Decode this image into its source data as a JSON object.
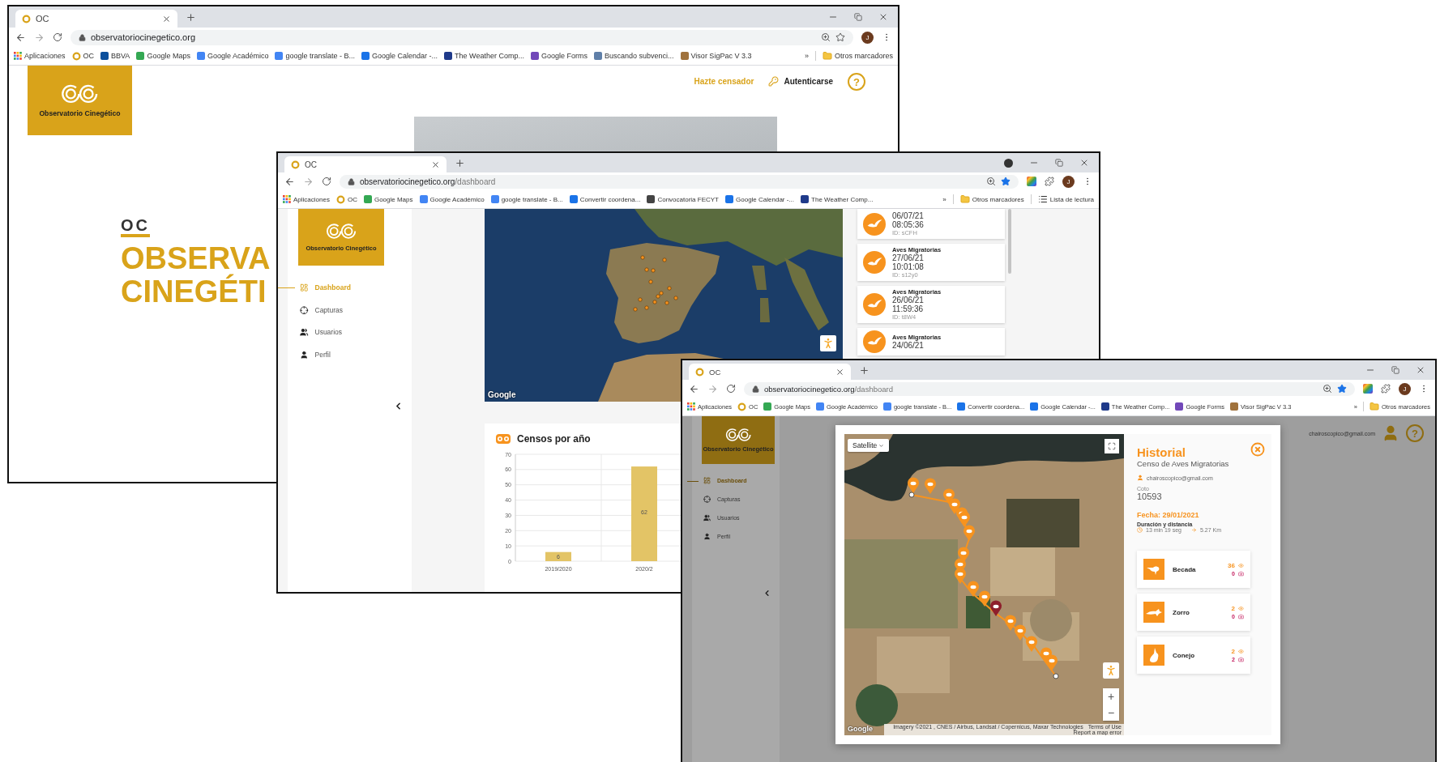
{
  "windows": [
    {
      "kind": "landing",
      "tab": "OC",
      "url": {
        "host": "observatoriocinegetico.org"
      },
      "bookmarked": false,
      "extensions": false,
      "media_indicator": false,
      "profile_initial": "J",
      "bookmarks": [
        {
          "label": "Aplicaciones",
          "kind": "apps"
        },
        {
          "label": "OC",
          "kind": "ring"
        },
        {
          "label": "BBVA",
          "kind": "site",
          "color": "#0b4f9c"
        },
        {
          "label": "Google Maps",
          "kind": "site",
          "color": "#34a853"
        },
        {
          "label": "Google Académico",
          "kind": "site",
          "color": "#4285f4"
        },
        {
          "label": "google translate - B...",
          "kind": "site",
          "color": "#4285f4"
        },
        {
          "label": "Google Calendar -...",
          "kind": "site",
          "color": "#1a73e8"
        },
        {
          "label": "The Weather Comp...",
          "kind": "site",
          "color": "#1f3a8a"
        },
        {
          "label": "Google Forms",
          "kind": "site",
          "color": "#7248b9"
        },
        {
          "label": "Buscando subvenci...",
          "kind": "site",
          "color": "#5f7fa8"
        },
        {
          "label": "Visor SigPac V 3.3",
          "kind": "site",
          "color": "#a0723c"
        },
        {
          "label": "»",
          "kind": "overflow"
        },
        {
          "label": "Otros marcadores",
          "kind": "folder"
        }
      ],
      "page": {
        "logo": "Observatorio Cinegético",
        "links": [
          {
            "label": "Hazte censador",
            "kind": "link"
          },
          {
            "label": "Autenticarse",
            "kind": "login"
          }
        ],
        "help": "?",
        "eyebrow": "OC",
        "headline": [
          "OBSERVA",
          "CINEGÉTI"
        ]
      }
    },
    {
      "kind": "dashboard",
      "tab": "OC",
      "url": {
        "host": "observatoriocinegetico.org",
        "path": "/dashboard"
      },
      "bookmarked": true,
      "extensions": true,
      "media_indicator": true,
      "profile_initial": "J",
      "bookmarks": [
        {
          "label": "Aplicaciones",
          "kind": "apps"
        },
        {
          "label": "OC",
          "kind": "ring"
        },
        {
          "label": "Google Maps",
          "kind": "site",
          "color": "#34a853"
        },
        {
          "label": "Google Académico",
          "kind": "site",
          "color": "#4285f4"
        },
        {
          "label": "google translate - B...",
          "kind": "site",
          "color": "#4285f4"
        },
        {
          "label": "Convertir coordena...",
          "kind": "site",
          "color": "#1a73e8"
        },
        {
          "label": "Convocatoria FECYT",
          "kind": "site",
          "color": "#444444"
        },
        {
          "label": "Google Calendar -...",
          "kind": "site",
          "color": "#1a73e8"
        },
        {
          "label": "The Weather Comp...",
          "kind": "site",
          "color": "#1f3a8a"
        },
        {
          "label": "»",
          "kind": "overflow"
        },
        {
          "label": "Otros marcadores",
          "kind": "folder"
        },
        {
          "label": "Lista de lectura",
          "kind": "reading"
        }
      ],
      "page": {
        "logo": "Observatorio Cinegético",
        "nav": [
          {
            "label": "Dashboard",
            "selected": true
          },
          {
            "label": "Capturas",
            "selected": false
          },
          {
            "label": "Usuarios",
            "selected": false
          },
          {
            "label": "Perfil",
            "selected": false
          }
        ],
        "map_credit": "Google",
        "records": [
          {
            "date": "06/07/21",
            "time": "08:05:36",
            "id": "ID: sCFH"
          },
          {
            "title": "Aves Migratorias",
            "date": "27/06/21",
            "time": "10:01:08",
            "id": "ID: s12y0"
          },
          {
            "title": "Aves Migratorias",
            "date": "26/06/21",
            "time": "11:59:36",
            "id": "ID: t8W4"
          },
          {
            "title": "Aves Migratorias",
            "date": "24/06/21"
          }
        ],
        "chart": {
          "title": "Censos por año",
          "chart_data": {
            "type": "bar",
            "categories": [
              "2019/2020",
              "2020/2"
            ],
            "values": [
              6,
              62
            ],
            "ylim": [
              0,
              70
            ],
            "grid": true,
            "yticks": [
              0,
              10,
              20,
              30,
              40,
              50,
              60,
              70
            ],
            "data_labels": true
          }
        }
      }
    },
    {
      "kind": "history",
      "tab": "OC",
      "url": {
        "host": "observatoriocinegetico.org",
        "path": "/dashboard"
      },
      "bookmarked": true,
      "extensions": true,
      "media_indicator": false,
      "profile_initial": "J",
      "bookmarks": [
        {
          "label": "Aplicaciones",
          "kind": "apps"
        },
        {
          "label": "OC",
          "kind": "ring"
        },
        {
          "label": "Google Maps",
          "kind": "site",
          "color": "#34a853"
        },
        {
          "label": "Google Académico",
          "kind": "site",
          "color": "#4285f4"
        },
        {
          "label": "google translate - B...",
          "kind": "site",
          "color": "#4285f4"
        },
        {
          "label": "Convertir coordena...",
          "kind": "site",
          "color": "#1a73e8"
        },
        {
          "label": "Google Calendar -...",
          "kind": "site",
          "color": "#1a73e8"
        },
        {
          "label": "The Weather Comp...",
          "kind": "site",
          "color": "#1f3a8a"
        },
        {
          "label": "Google Forms",
          "kind": "site",
          "color": "#7248b9"
        },
        {
          "label": "Visor SigPac V 3.3",
          "kind": "site",
          "color": "#a0723c"
        },
        {
          "label": "»",
          "kind": "overflow"
        },
        {
          "label": "Otros marcadores",
          "kind": "folder"
        }
      ],
      "page": {
        "logo": "Observatorio Cinegético",
        "nav": [
          {
            "label": "Dashboard",
            "selected": true
          },
          {
            "label": "Capturas",
            "selected": false
          },
          {
            "label": "Usuarios",
            "selected": false
          },
          {
            "label": "Perfil",
            "selected": false
          }
        ],
        "user_email": "chairoscopico@gmail.com",
        "help": "?",
        "modal": {
          "map": {
            "layer_button": "Satellite",
            "credit": "Google",
            "attribution": "Imagery ©2021 , CNES / Airbus, Landsat / Copernicus, Maxar Technologies",
            "terms": "Terms of Use",
            "report": "Report a map error",
            "zoom_in": "+",
            "zoom_out": "−"
          },
          "title": "Historial",
          "subtitle": "Censo de Aves Migratorias",
          "email": "chairoscopico@gmail.com",
          "coto_label": "Coto",
          "coto": "10593",
          "date": "Fecha: 29/01/2021",
          "duration_label": "Duración y distancia",
          "duration": "13 min 19 seg",
          "distance": "5.27 Km",
          "species": [
            {
              "name": "Becada",
              "kind": "bird",
              "seen": "36",
              "captured": "0"
            },
            {
              "name": "Zorro",
              "kind": "fox",
              "seen": "2",
              "captured": "0"
            },
            {
              "name": "Conejo",
              "kind": "rabbit",
              "seen": "2",
              "captured": "2"
            }
          ]
        }
      }
    }
  ]
}
